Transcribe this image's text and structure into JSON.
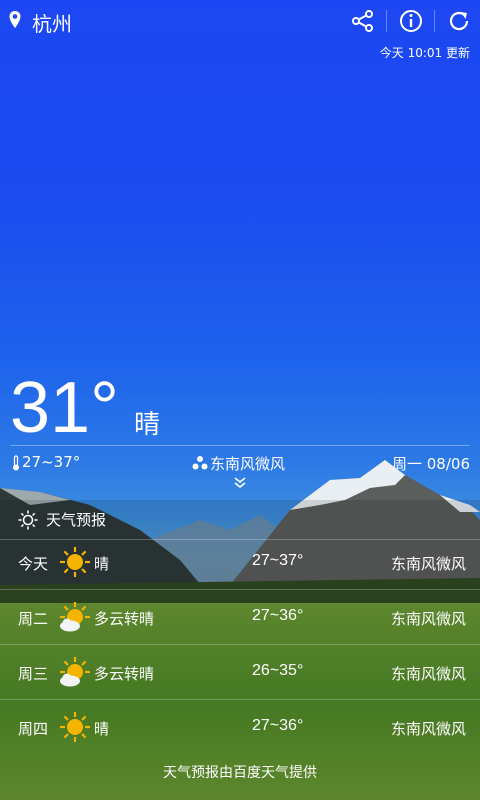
{
  "header": {
    "city": "杭州",
    "update_text": "今天 10:01 更新"
  },
  "current": {
    "temperature": "31°",
    "condition": "晴",
    "temp_range": "27~37°",
    "wind": "东南风微风",
    "date": "周一 08/06"
  },
  "forecast": {
    "title": "天气预报",
    "days": [
      {
        "day": "今天",
        "condition": "晴",
        "icon": "sun-icon",
        "temp": "27~37°",
        "wind": "东南风微风"
      },
      {
        "day": "周二",
        "condition": "多云转晴",
        "icon": "sun-cloud-icon",
        "temp": "27~36°",
        "wind": "东南风微风"
      },
      {
        "day": "周三",
        "condition": "多云转晴",
        "icon": "sun-cloud-icon",
        "temp": "26~35°",
        "wind": "东南风微风"
      },
      {
        "day": "周四",
        "condition": "晴",
        "icon": "sun-icon",
        "temp": "27~36°",
        "wind": "东南风微风"
      }
    ],
    "footer": "天气预报由百度天气提供"
  },
  "colors": {
    "sky_top": "#1d47f2",
    "grass": "#5d8f2a",
    "sun": "#f5b400"
  }
}
